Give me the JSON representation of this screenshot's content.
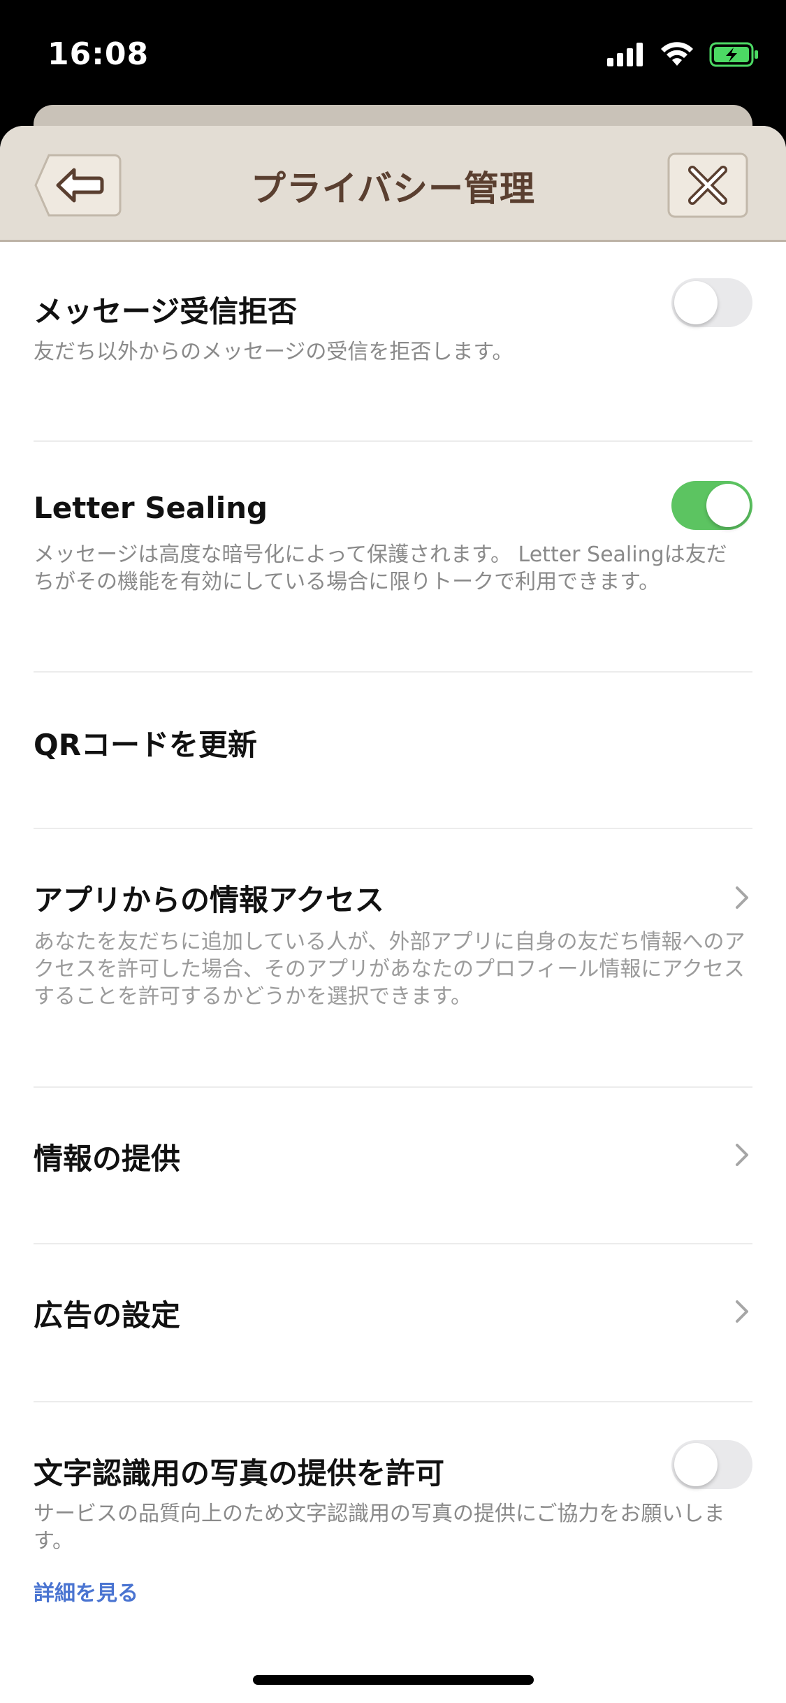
{
  "status": {
    "time": "16:08",
    "icons": [
      "signal-icon",
      "wifi-icon",
      "battery-charging-icon"
    ],
    "battery_color": "#4cd964"
  },
  "nav": {
    "title": "プライバシー管理",
    "back_icon": "back-arrow-icon",
    "close_icon": "close-icon",
    "background": "#e3ddd4",
    "title_color": "#5a3f30"
  },
  "settings": [
    {
      "title": "メッセージ受信拒否",
      "description": "友だち以外からのメッセージの受信を拒否します。",
      "control": "toggle",
      "enabled": false
    },
    {
      "title": "Letter Sealing",
      "description_lines": [
        "メッセージは高度な暗号化によって保護されます。 Letter Sealingは友だ",
        "ちがその機能を有効にしている場合に限りトークで利用できます。"
      ],
      "control": "toggle",
      "enabled": true
    },
    {
      "title": "QRコードを更新",
      "control": "none"
    },
    {
      "title": "アプリからの情報アクセス",
      "description_lines": [
        "あなたを友だちに追加している人が、外部アプリに自身の友だち情報へのア",
        "クセスを許可した場合、そのアプリがあなたのプロフィール情報にアクセス",
        "することを許可するかどうかを選択できます。"
      ],
      "control": "chevron"
    },
    {
      "title": "情報の提供",
      "control": "chevron"
    },
    {
      "title": "広告の設定",
      "control": "chevron"
    },
    {
      "title": "文字認識用の写真の提供を許可",
      "description_lines": [
        "サービスの品質向上のため文字認識用の写真の提供にご協力をお願いしま",
        "す。"
      ],
      "control": "toggle",
      "enabled": false,
      "link": "詳細を見る"
    }
  ],
  "colors": {
    "toggle_on": "#5cc461",
    "toggle_off": "#e9e9eb",
    "link": "#4a74d1"
  }
}
